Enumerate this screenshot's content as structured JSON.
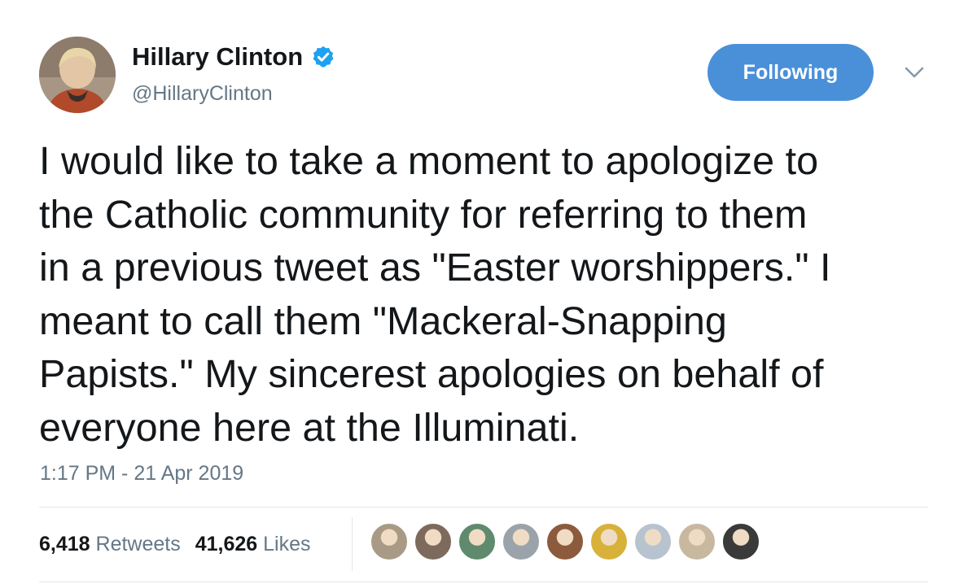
{
  "author": {
    "display_name": "Hillary Clinton",
    "handle": "@HillaryClinton",
    "verified": true,
    "verified_color": "#1da1f2"
  },
  "follow_button": {
    "label": "Following",
    "color": "#4a90d9"
  },
  "menu_icon": "chevron-down-icon",
  "tweet": {
    "text": "I would like to take a moment to apologize to\nthe Catholic community for referring to them\nin a previous tweet as \"Easter worshippers.\" I\nmeant to call them \"Mackeral-Snapping\nPapists.\" My sincerest apologies on behalf of\neveryone here at the Illuminati.",
    "timestamp": "1:17 PM - 21 Apr 2019"
  },
  "stats": {
    "retweets_count": "6,418",
    "retweets_label": "Retweets",
    "likes_count": "41,626",
    "likes_label": "Likes"
  },
  "likers": [
    {
      "name": "liker-avatar-1",
      "color": "#a99a86"
    },
    {
      "name": "liker-avatar-2",
      "color": "#7d6a5c"
    },
    {
      "name": "liker-avatar-3",
      "color": "#5f8a6e"
    },
    {
      "name": "liker-avatar-4",
      "color": "#9aa3aa"
    },
    {
      "name": "liker-avatar-5",
      "color": "#8c5a3c"
    },
    {
      "name": "liker-avatar-6",
      "color": "#d8b13a"
    },
    {
      "name": "liker-avatar-7",
      "color": "#b7c4cf"
    },
    {
      "name": "liker-avatar-8",
      "color": "#c9b8a0"
    },
    {
      "name": "liker-avatar-9",
      "color": "#3a3a3a"
    }
  ]
}
